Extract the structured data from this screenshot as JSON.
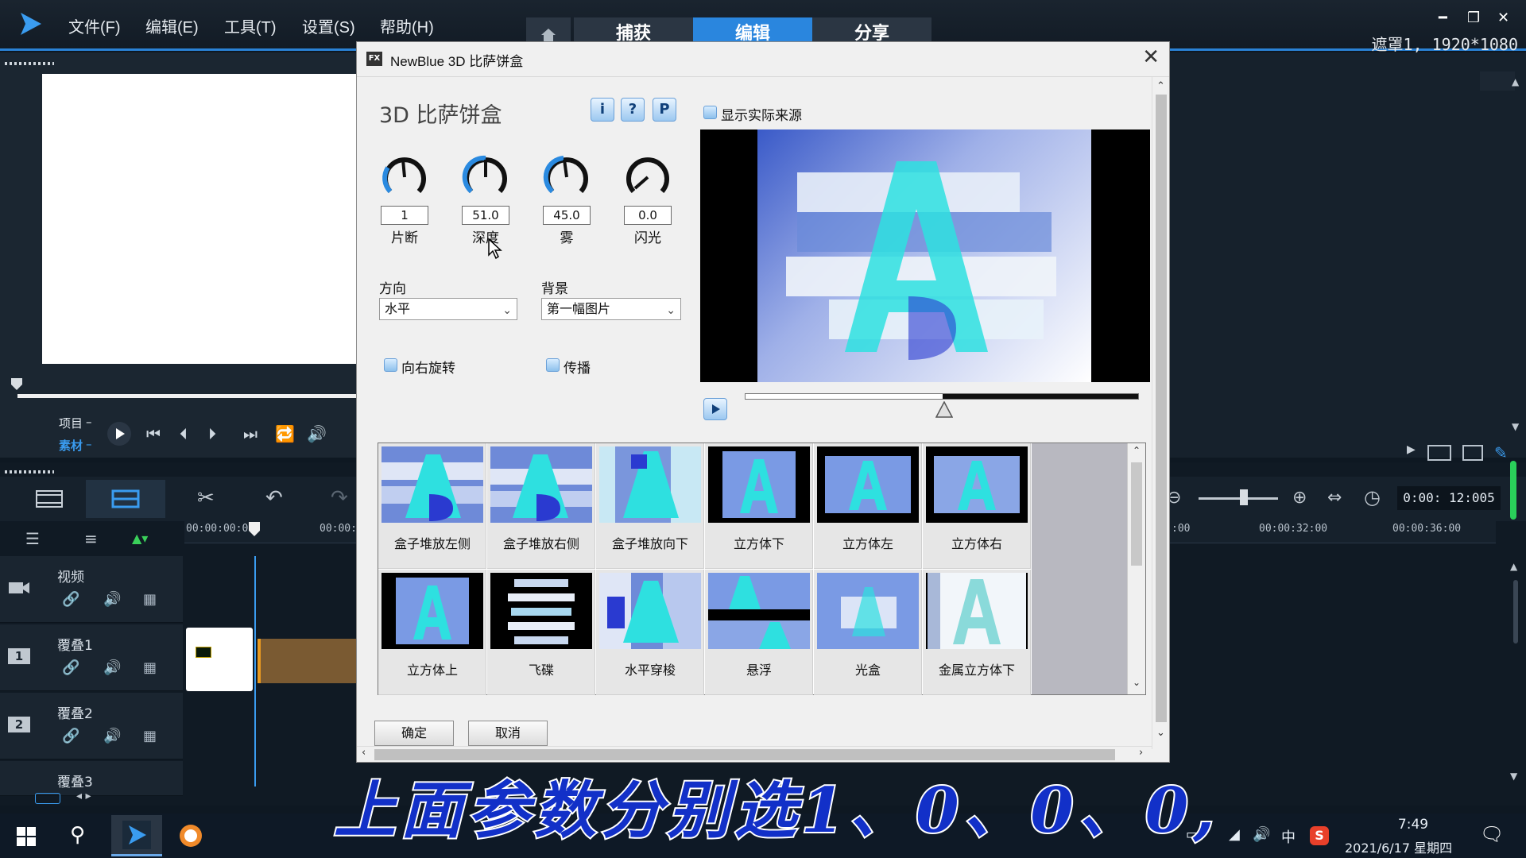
{
  "menu": [
    "文件(F)",
    "编辑(E)",
    "工具(T)",
    "设置(S)",
    "帮助(H)"
  ],
  "tabs": {
    "capture": "捕获",
    "edit": "编辑",
    "share": "分享"
  },
  "window_info": "遮罩1, 1920*1080",
  "player": {
    "project": "项目",
    "clip": "素材"
  },
  "timeline": {
    "timecode": "0:00: 12:005",
    "ruler": [
      "00:00:00:00",
      "00:00:",
      "00:00:32:00",
      "00:00:36:00",
      ":00"
    ],
    "tracks": [
      {
        "name": "视频",
        "number": ""
      },
      {
        "name": "覆叠1",
        "number": "1"
      },
      {
        "name": "覆叠2",
        "number": "2"
      },
      {
        "name": "覆叠3",
        "number": ""
      }
    ]
  },
  "dialog": {
    "title": "NewBlue 3D 比萨饼盒",
    "heading": "3D 比萨饼盒",
    "help_buttons": [
      "i",
      "?",
      "P"
    ],
    "show_source": "显示实际来源",
    "knobs": [
      {
        "label": "片断",
        "value": "1"
      },
      {
        "label": "深度",
        "value": "51.0"
      },
      {
        "label": "雾",
        "value": "45.0"
      },
      {
        "label": "闪光",
        "value": "0.0"
      }
    ],
    "direction": {
      "label": "方向",
      "value": "水平"
    },
    "background": {
      "label": "背景",
      "value": "第一幅图片"
    },
    "rotate_right": "向右旋转",
    "spread": "传播",
    "presets": [
      "盒子堆放左侧",
      "盒子堆放右侧",
      "盒子堆放向下",
      "立方体下",
      "立方体左",
      "立方体右",
      "立方体上",
      "飞碟",
      "水平穿梭",
      "悬浮",
      "光盒",
      "金属立方体下"
    ],
    "ok": "确定",
    "cancel": "取消"
  },
  "subtitle": "上面参数分别选1、0、0、0,",
  "taskbar": {
    "ime": "中",
    "time": "7:49",
    "date": "2021/6/17 星期四"
  }
}
